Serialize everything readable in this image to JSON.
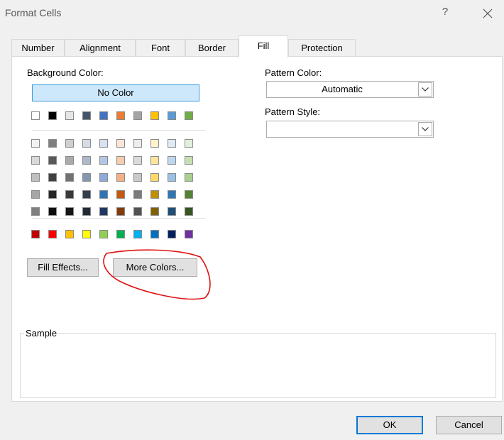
{
  "window": {
    "title": "Format Cells",
    "help": "?",
    "close": "✕"
  },
  "tabs": [
    {
      "label": "Number"
    },
    {
      "label": "Alignment"
    },
    {
      "label": "Font"
    },
    {
      "label": "Border"
    },
    {
      "label": "Fill",
      "active": true
    },
    {
      "label": "Protection"
    }
  ],
  "fill": {
    "background_color_label": "Background Color:",
    "no_color_label": "No Color",
    "pattern_color_label": "Pattern Color:",
    "pattern_color_value": "Automatic",
    "pattern_style_label": "Pattern Style:",
    "pattern_style_value": "",
    "fill_effects_label": "Fill Effects...",
    "more_colors_label": "More Colors...",
    "sample_label": "Sample",
    "palette": {
      "theme_row": [
        "#ffffff",
        "#000000",
        "#e7e6e6",
        "#44546a",
        "#4472c4",
        "#ed7d31",
        "#a5a5a5",
        "#ffc000",
        "#5b9bd5",
        "#70ad47"
      ],
      "shade_rows": [
        [
          "#f2f2f2",
          "#7f7f7f",
          "#d0cece",
          "#d6dce4",
          "#d9e1f2",
          "#fce4d6",
          "#ededed",
          "#fff2cc",
          "#ddebf7",
          "#e2efda"
        ],
        [
          "#d9d9d9",
          "#595959",
          "#aeaaaa",
          "#acb9ca",
          "#b4c6e7",
          "#f8cbad",
          "#dbdbdb",
          "#ffe699",
          "#bdd7ee",
          "#c6e0b4"
        ],
        [
          "#bfbfbf",
          "#404040",
          "#757171",
          "#8497b0",
          "#8ea9db",
          "#f4b084",
          "#c9c9c9",
          "#ffd966",
          "#9bc2e6",
          "#a9d08e"
        ],
        [
          "#a6a6a6",
          "#262626",
          "#3a3838",
          "#333f4f",
          "#2f75b5",
          "#c65911",
          "#7b7b7b",
          "#bf8f00",
          "#2e75b6",
          "#548235"
        ],
        [
          "#808080",
          "#0d0d0d",
          "#161616",
          "#222b35",
          "#203764",
          "#833c0c",
          "#525252",
          "#806000",
          "#1f4e78",
          "#375623"
        ]
      ],
      "standard_row": [
        "#c00000",
        "#ff0000",
        "#ffc000",
        "#ffff00",
        "#92d050",
        "#00b050",
        "#00b0f0",
        "#0070c0",
        "#002060",
        "#7030a0"
      ]
    }
  },
  "footer": {
    "ok_label": "OK",
    "cancel_label": "Cancel"
  },
  "colors": {
    "accent": "#0078d7",
    "annotation": "#e01010"
  }
}
